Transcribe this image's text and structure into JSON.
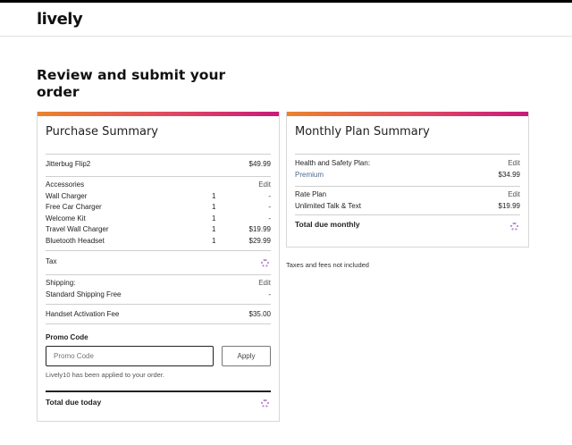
{
  "header": {
    "logo": "lively"
  },
  "page_title": "Review and submit your order",
  "purchase": {
    "title": "Purchase Summary",
    "device": {
      "label": "Jitterbug Flip2",
      "price": "$49.99"
    },
    "accessories": {
      "label": "Accessories",
      "edit": "Edit",
      "items": [
        {
          "name": "Wall Charger",
          "qty": "1",
          "price": "-"
        },
        {
          "name": "Free Car Charger",
          "qty": "1",
          "price": "-"
        },
        {
          "name": "Welcome Kit",
          "qty": "1",
          "price": "-"
        },
        {
          "name": "Travel Wall Charger",
          "qty": "1",
          "price": "$19.99"
        },
        {
          "name": "Bluetooth Headset",
          "qty": "1",
          "price": "$29.99"
        }
      ]
    },
    "tax_label": "Tax",
    "shipping": {
      "label": "Shipping:",
      "edit": "Edit",
      "method": "Standard Shipping Free",
      "price": "-"
    },
    "activation": {
      "label": "Handset Activation Fee",
      "price": "$35.00"
    },
    "promo": {
      "label": "Promo Code",
      "placeholder": "Promo Code",
      "apply": "Apply",
      "message": "Lively10 has been applied to your order."
    },
    "total_label": "Total due today"
  },
  "monthly": {
    "title": "Monthly Plan Summary",
    "health": {
      "label": "Health and Safety Plan:",
      "edit": "Edit",
      "plan": "Premium",
      "price": "$34.99"
    },
    "rate": {
      "label": "Rate Plan",
      "edit": "Edit",
      "plan": "Unlimited Talk & Text",
      "price": "$19.99"
    },
    "total_label": "Total due monthly"
  },
  "taxes_note": "Taxes and fees not included",
  "colors": {
    "accent_start": "#e9852e",
    "accent_mid": "#e04862",
    "accent_end": "#c81a7a",
    "spinner": "#b58bd0"
  }
}
